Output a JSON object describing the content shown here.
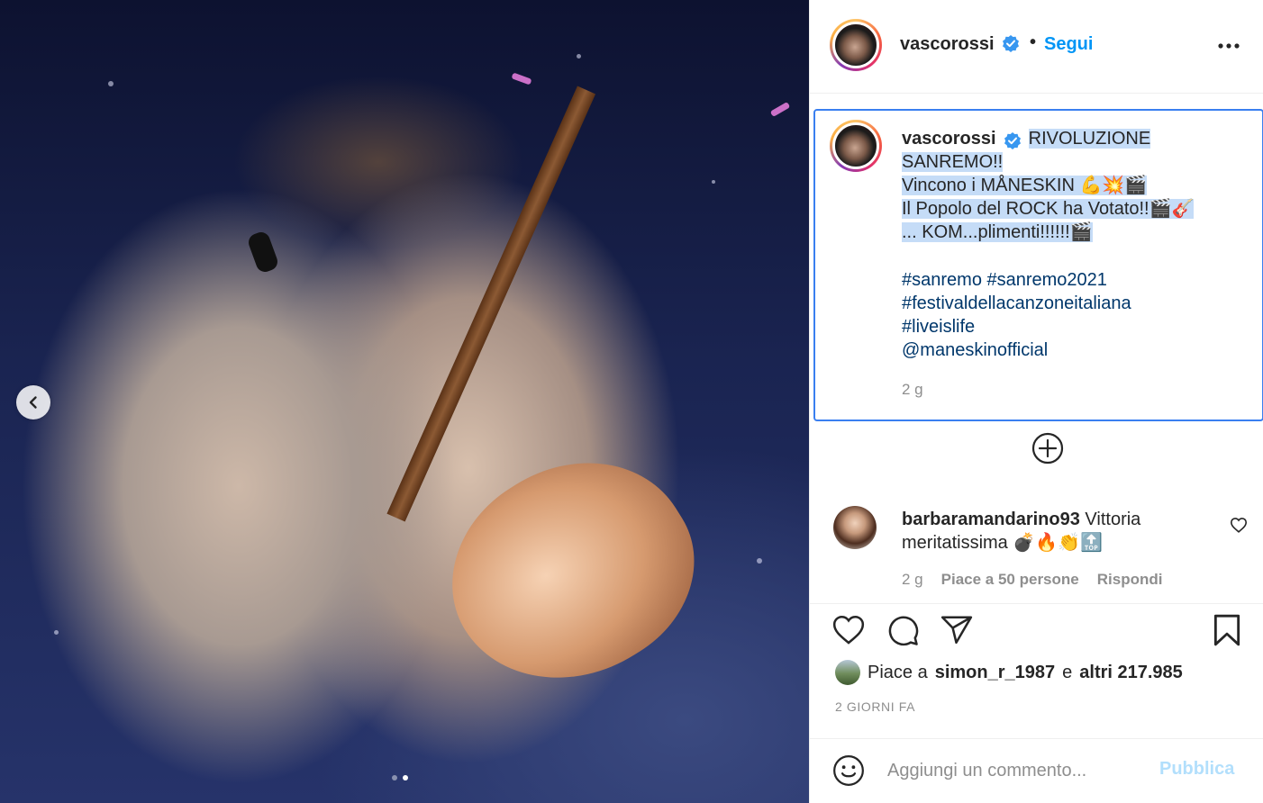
{
  "post": {
    "author": "vascorossi",
    "follow_separator": "•",
    "follow_label": "Segui",
    "media_slides": 2,
    "active_slide": 2
  },
  "caption": {
    "username": "vascorossi",
    "lines": [
      "RIVOLUZIONE SANREMO!!",
      "Vincono i MÅNESKIN 💪💥🎬",
      "Il Popolo del ROCK ha Votato!!🎬🎸",
      "... KOM...plimenti!!!!!!🎬"
    ],
    "tags": [
      "#sanremo #sanremo2021",
      "#festivaldellacanzoneitaliana",
      "#liveislife",
      "@maneskinofficial"
    ],
    "age": "2 g"
  },
  "comments": [
    {
      "username": "barbaramandarino93",
      "text": "Vittoria meritatissima 💣🔥👏🔝",
      "age": "2 g",
      "likes_label": "Piace a 50 persone",
      "reply_label": "Rispondi"
    }
  ],
  "likes": {
    "prefix": "Piace a",
    "first_user": "simon_r_1987",
    "joiner": "e",
    "others": "altri 217.985"
  },
  "date_label": "2 GIORNI FA",
  "add_comment": {
    "placeholder": "Aggiungi un commento...",
    "publish_label": "Pubblica"
  },
  "colors": {
    "link_blue": "#0095f6",
    "tag_blue": "#00376b",
    "selection": "#c5dcf7",
    "focus_border": "#3a7ff0",
    "muted": "#8e8e8e"
  },
  "icons": [
    "chevron-left-icon",
    "more-icon",
    "verified-icon",
    "add-circle-icon",
    "heart-icon",
    "comment-icon",
    "share-icon",
    "bookmark-icon",
    "emoji-icon"
  ]
}
